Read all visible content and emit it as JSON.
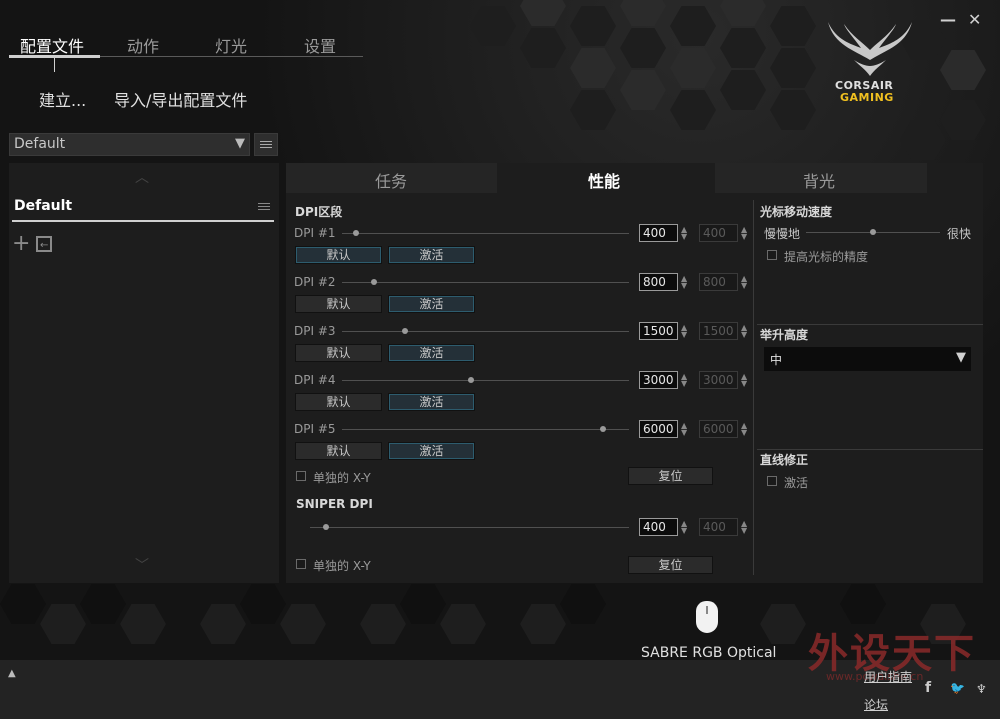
{
  "window": {
    "minimize_label": "—",
    "close_label": "✕"
  },
  "brand": {
    "line1": "CORSAIR",
    "line2": "GAMING"
  },
  "main_nav": [
    {
      "label": "配置文件",
      "active": true
    },
    {
      "label": "动作",
      "active": false
    },
    {
      "label": "灯光",
      "active": false
    },
    {
      "label": "设置",
      "active": false
    }
  ],
  "sub_nav": {
    "create_label": "建立...",
    "import_export_label": "导入/导出配置文件"
  },
  "profile_select": {
    "value": "Default"
  },
  "profile_list": {
    "items": [
      {
        "label": "Default"
      }
    ]
  },
  "tabs": [
    {
      "label": "任务",
      "active": false
    },
    {
      "label": "性能",
      "active": true
    },
    {
      "label": "背光",
      "active": false
    }
  ],
  "dpi": {
    "section_title": "DPI区段",
    "default_label": "默认",
    "activate_label": "激活",
    "stages": [
      {
        "label": "DPI #1",
        "x": "400",
        "y": "400",
        "level": 0.05
      },
      {
        "label": "DPI #2",
        "x": "800",
        "y": "800",
        "level": 0.11
      },
      {
        "label": "DPI #3",
        "x": "1500",
        "y": "1500",
        "level": 0.22
      },
      {
        "label": "DPI #4",
        "x": "3000",
        "y": "3000",
        "level": 0.45
      },
      {
        "label": "DPI #5",
        "x": "6000",
        "y": "6000",
        "level": 0.91
      }
    ],
    "independent_xy_label": "单独的 X-Y",
    "reset_label": "复位"
  },
  "sniper": {
    "title": "SNIPER DPI",
    "x": "400",
    "y": "400",
    "level": 0.05,
    "independent_xy_label": "单独的 X-Y",
    "reset_label": "复位"
  },
  "pointer_speed": {
    "title": "光标移动速度",
    "slow_label": "慢慢地",
    "fast_label": "很快",
    "level": 0.5,
    "precision_label": "提高光标的精度"
  },
  "lift_height": {
    "title": "举升高度",
    "value": "中"
  },
  "angle_snap": {
    "title": "直线修正",
    "enable_label": "激活"
  },
  "device": {
    "name": "SABRE RGB Optical"
  },
  "footer": {
    "guide_label": "用户指南",
    "forum_label": "论坛",
    "up_label": "▲"
  },
  "watermark": {
    "text": "外设天下",
    "url": "www.pcwaishe.cn"
  },
  "colors": {
    "accent_glow": "#2d5c6e",
    "background": "#141414",
    "panel": "#1d1d1d"
  }
}
